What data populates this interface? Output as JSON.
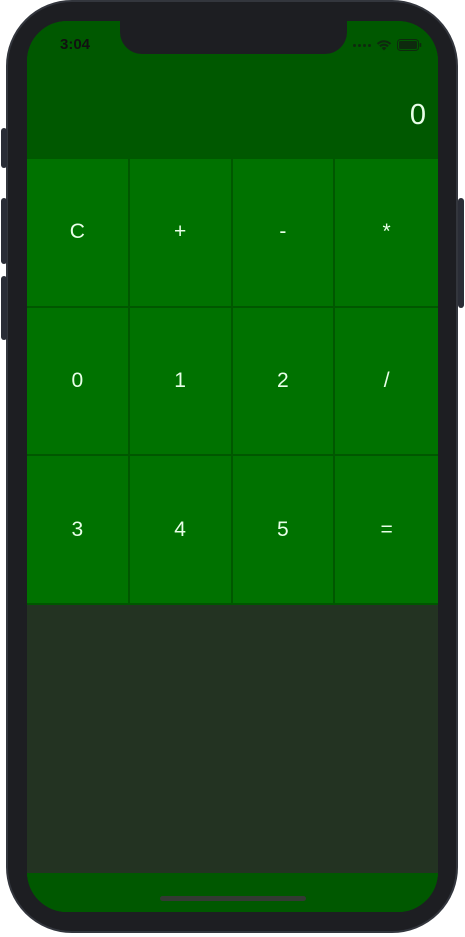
{
  "status_bar": {
    "time": "3:04",
    "icons": [
      "signal-dots-icon",
      "wifi-icon",
      "battery-icon"
    ]
  },
  "display": {
    "value": "0"
  },
  "keypad": {
    "keys": [
      "C",
      "+",
      "-",
      "*",
      "0",
      "1",
      "2",
      "/",
      "3",
      "4",
      "5",
      "="
    ]
  },
  "colors": {
    "display_bg": "#005800",
    "key_bg": "#007200",
    "key_border": "#005700",
    "lower_panel": "#233322",
    "key_text": "#e8ffe8"
  }
}
